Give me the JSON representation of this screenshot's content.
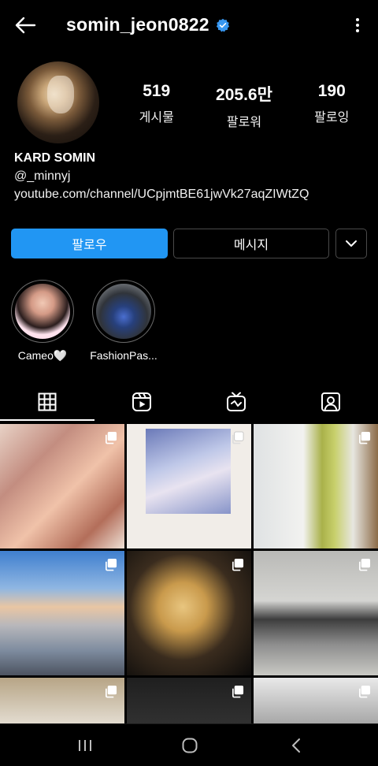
{
  "header": {
    "username": "somin_jeon0822",
    "verified_icon": "verified-badge-icon",
    "accent": "#3897f0"
  },
  "stats": {
    "posts_value": "519",
    "posts_label": "게시물",
    "followers_value": "205.6만",
    "followers_label": "팔로워",
    "following_value": "190",
    "following_label": "팔로잉"
  },
  "bio": {
    "name": "KARD SOMIN",
    "handle": "@_minnyj",
    "link": "youtube.com/channel/UCpjmtBE61jwVk27aqZIWtZQ"
  },
  "actions": {
    "follow_label": "팔로우",
    "message_label": "메시지",
    "follow_color": "#2196f3"
  },
  "highlights": [
    {
      "caption": "Cameo🤍"
    },
    {
      "caption": "FashionPas..."
    }
  ],
  "tabs": [
    {
      "icon": "grid-icon",
      "active": true
    },
    {
      "icon": "reels-icon",
      "active": false
    },
    {
      "icon": "igtv-icon",
      "active": false
    },
    {
      "icon": "tagged-icon",
      "active": false
    }
  ],
  "navbar": {
    "icons": [
      "recent-apps-icon",
      "home-icon",
      "back-nav-icon"
    ]
  }
}
